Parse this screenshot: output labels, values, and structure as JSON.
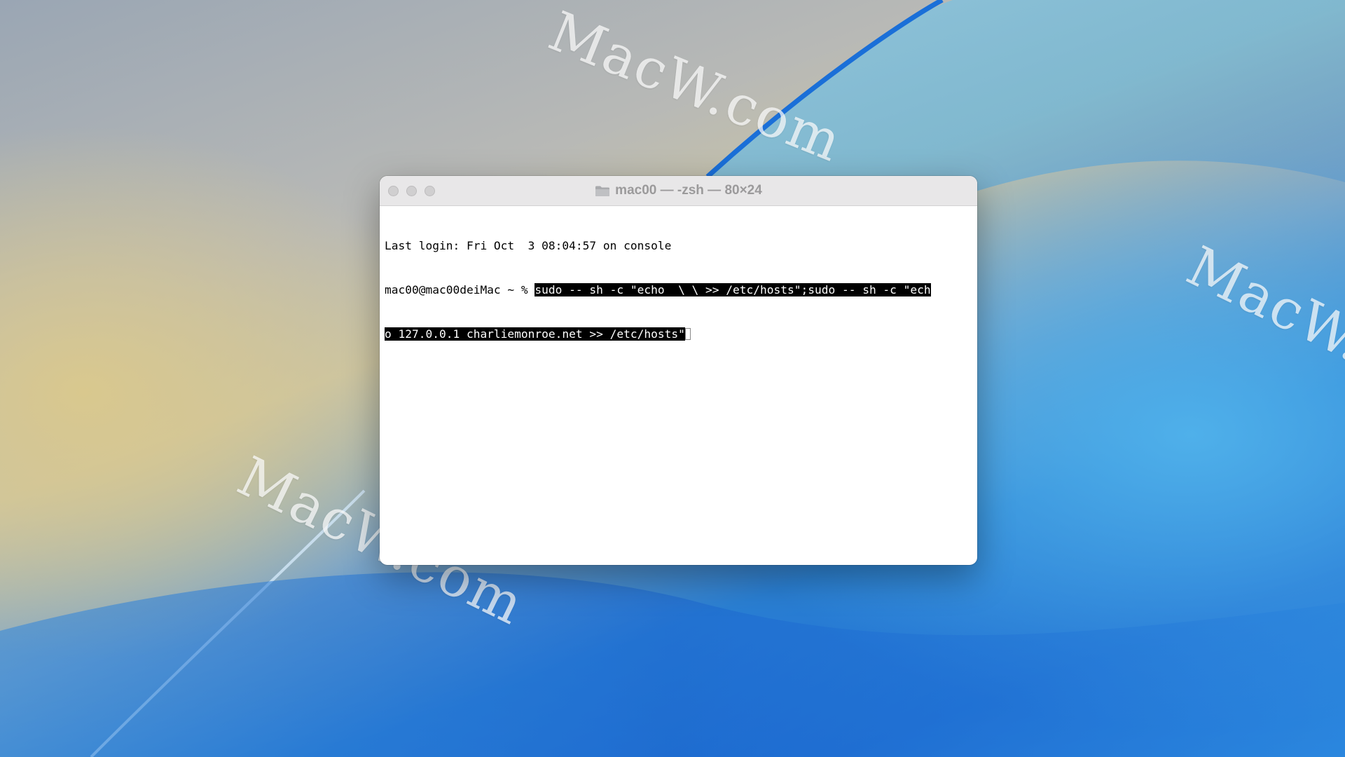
{
  "desktop": {
    "watermarks": [
      "MacW.com",
      "MacW.com",
      "MacW.c"
    ]
  },
  "terminal": {
    "title": "mac00 — -zsh — 80×24",
    "title_icon": "folder-icon",
    "lines": {
      "login": "Last login: Fri Oct  3 08:04:57 on console",
      "prompt": "mac00@mac00deiMac ~ % ",
      "command_part1": "sudo -- sh -c \"echo  \\ \\ >> /etc/hosts\";sudo -- sh -c \"ech",
      "command_part2": "o 127.0.0.1 charliemonroe.net >> /etc/hosts\""
    }
  },
  "colors": {
    "selection_bg": "#000000",
    "selection_fg": "#ffffff",
    "titlebar": "#e8e7e8"
  }
}
